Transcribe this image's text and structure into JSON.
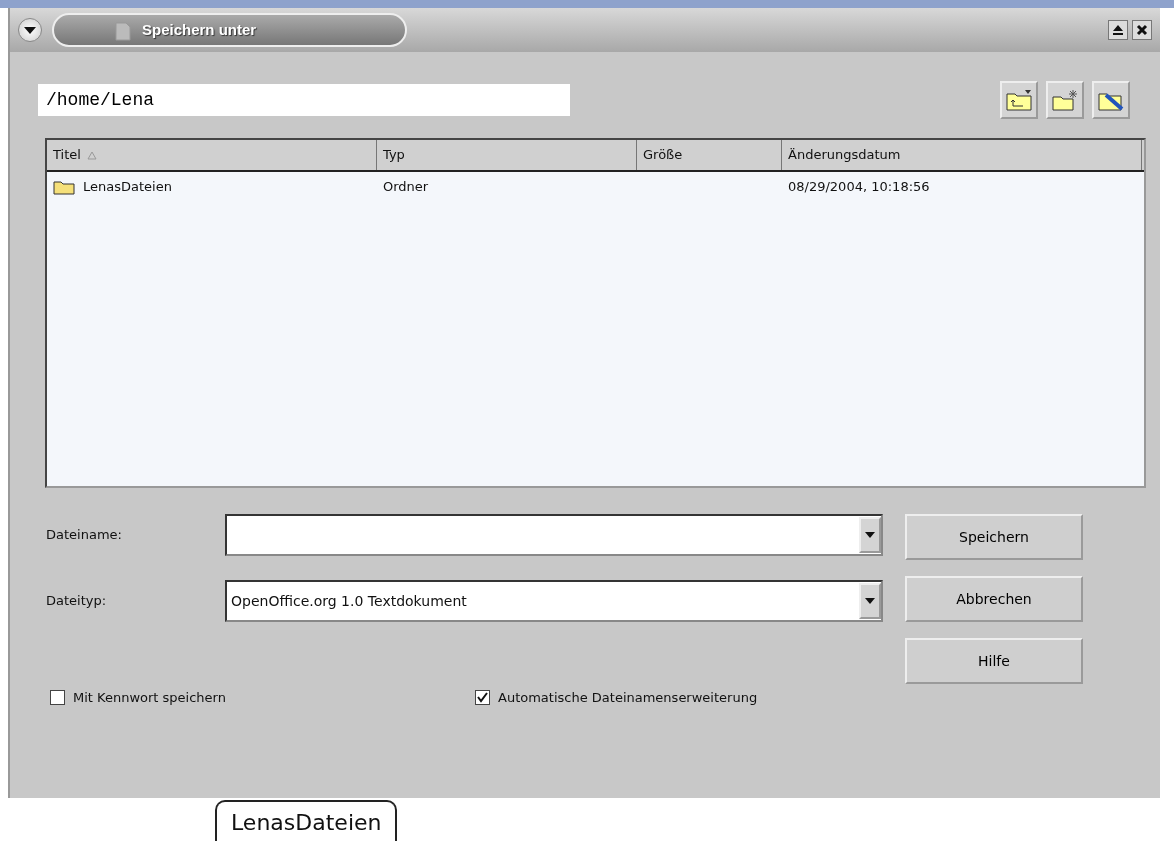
{
  "window": {
    "title": "Speichern unter"
  },
  "path": {
    "value": "/home/Lena"
  },
  "table": {
    "columns": [
      {
        "label": "Titel",
        "sorted": true
      },
      {
        "label": "Typ",
        "sorted": false
      },
      {
        "label": "Größe",
        "sorted": false
      },
      {
        "label": "Änderungsdatum",
        "sorted": false
      }
    ],
    "rows": [
      {
        "kind": "folder",
        "cells": [
          "LenasDateien",
          "Ordner",
          "",
          "08/29/2004, 10:18:56"
        ]
      }
    ]
  },
  "fields": [
    {
      "label": "Dateiname:"
    },
    {
      "label": "Dateityp:",
      "value": "OpenOffice.org 1.0 Textdokument"
    }
  ],
  "buttons": [
    "Speichern",
    "Abbrechen",
    "Hilfe"
  ],
  "checkboxes": [
    {
      "label": "Mit Kennwort speichern",
      "checked": false
    },
    {
      "label": "Automatische Dateinamenserweiterung",
      "checked": true
    }
  ],
  "tooltip": {
    "text": "LenasDateien"
  }
}
